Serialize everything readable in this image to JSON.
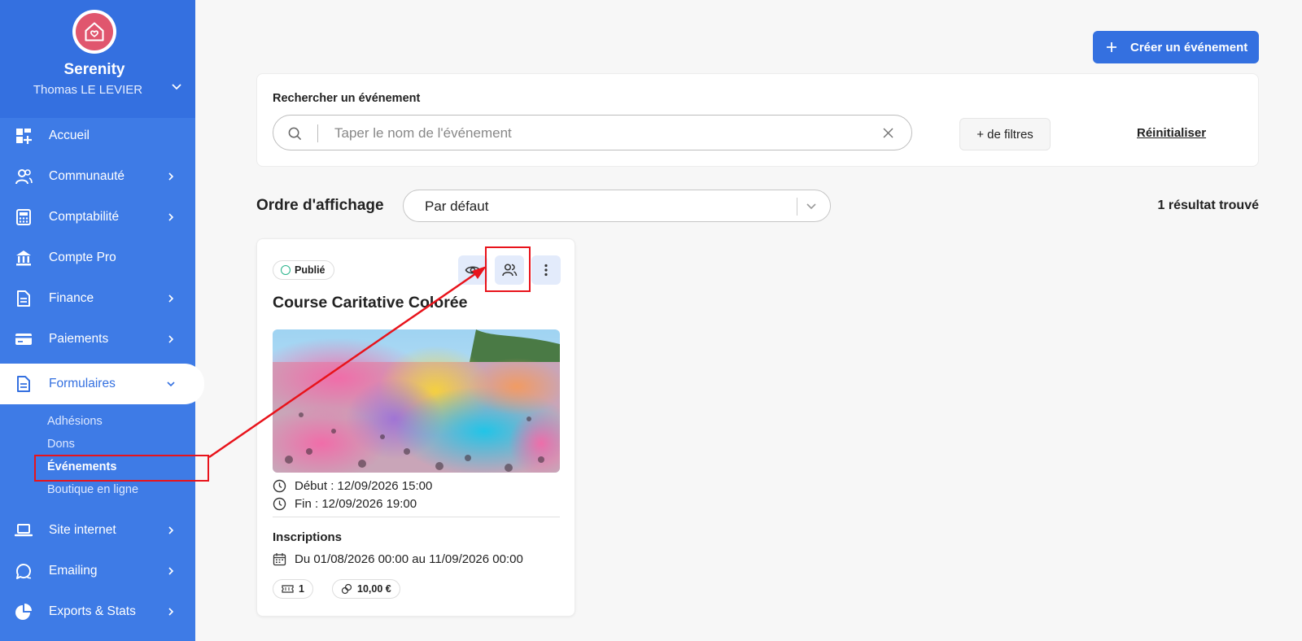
{
  "org": {
    "name": "Serenity",
    "user": "Thomas LE LEVIER"
  },
  "nav": [
    {
      "label": "Accueil",
      "icon": "dashboard-icon"
    },
    {
      "label": "Communauté",
      "icon": "community-icon"
    },
    {
      "label": "Comptabilité",
      "icon": "calculator-icon"
    },
    {
      "label": "Compte Pro",
      "icon": "bank-icon"
    },
    {
      "label": "Finance",
      "icon": "document-icon"
    },
    {
      "label": "Paiements",
      "icon": "card-icon"
    },
    {
      "label": "Formulaires",
      "icon": "form-icon"
    },
    {
      "label": "Site internet",
      "icon": "laptop-icon"
    },
    {
      "label": "Emailing",
      "icon": "chat-icon"
    },
    {
      "label": "Exports & Stats",
      "icon": "pie-chart-icon"
    }
  ],
  "subnav": [
    "Adhésions",
    "Dons",
    "Événements",
    "Boutique en ligne"
  ],
  "header": {
    "create_label": "Créer un événement"
  },
  "search": {
    "title": "Rechercher un événement",
    "placeholder": "Taper le nom de l'événement",
    "filters_label": "+ de filtres",
    "reset_label": "Réinitialiser"
  },
  "order": {
    "label": "Ordre d'affichage",
    "selected": "Par défaut"
  },
  "results": "1 résultat trouvé",
  "event": {
    "status": "Publié",
    "title": "Course Caritative Colorée",
    "start": "Début : 12/09/2026 15:00",
    "end": "Fin : 12/09/2026 19:00",
    "registrations_title": "Inscriptions",
    "registrations_period": "Du 01/08/2026 00:00 au 11/09/2026 00:00",
    "tickets": "1",
    "price": "10,00 €"
  },
  "colors": {
    "sidebar": "#3e7be6",
    "primary": "#3470e0",
    "annotation": "#e8131b",
    "status_green": "#27b38a"
  }
}
